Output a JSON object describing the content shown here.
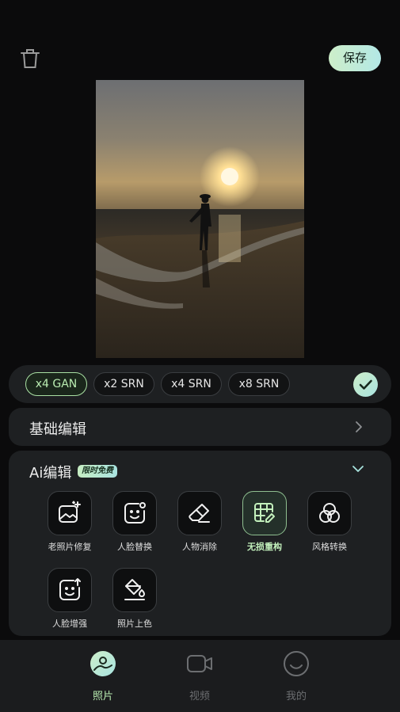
{
  "header": {
    "save_label": "保存",
    "trash_icon": "trash-icon"
  },
  "models": [
    {
      "label": "x4 GAN",
      "selected": true
    },
    {
      "label": "x2 SRN",
      "selected": false
    },
    {
      "label": "x4 SRN",
      "selected": false
    },
    {
      "label": "x8 SRN",
      "selected": false
    }
  ],
  "basic_edit": {
    "label": "基础编辑"
  },
  "ai_edit": {
    "title": "Ai编辑",
    "badge": "限时免费",
    "tools": [
      {
        "label": "老照片修复",
        "icon": "photo-sparkle-icon"
      },
      {
        "label": "人脸替换",
        "icon": "face-swap-icon"
      },
      {
        "label": "人物消除",
        "icon": "eraser-icon"
      },
      {
        "label": "无损重构",
        "icon": "grid-edit-icon",
        "active": true
      },
      {
        "label": "风格转换",
        "icon": "style-circles-icon"
      },
      {
        "label": "人脸增强",
        "icon": "face-enhance-icon"
      },
      {
        "label": "照片上色",
        "icon": "paint-bucket-icon"
      }
    ]
  },
  "nav": [
    {
      "label": "照片",
      "icon": "photo-icon",
      "active": true
    },
    {
      "label": "视频",
      "icon": "video-icon"
    },
    {
      "label": "我的",
      "icon": "profile-smile-icon"
    }
  ],
  "colors": {
    "accent": "#b9ecb1",
    "accent_gradient_end": "#a9e3e0",
    "panel": "#1e2022",
    "background": "#0b0b0c"
  }
}
